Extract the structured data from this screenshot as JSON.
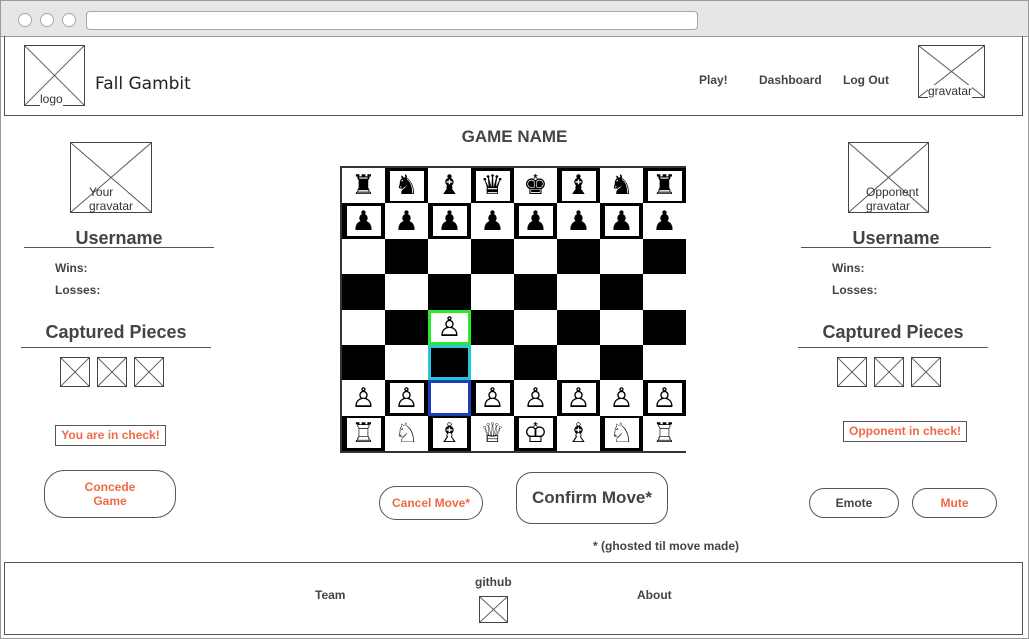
{
  "header": {
    "logo_caption": "logo",
    "brand": "Fall Gambit",
    "nav": [
      {
        "label": "Play!"
      },
      {
        "label": "Dashboard"
      },
      {
        "label": "Log Out"
      }
    ],
    "gravatar_caption": "gravatar"
  },
  "game_name": "GAME NAME",
  "player": {
    "avatar_caption_1": "Your",
    "avatar_caption_2": "gravatar",
    "username": "Username",
    "wins_label": "Wins:",
    "losses_label": "Losses:",
    "captured_title": "Captured Pieces",
    "check_alert": "You are in check!",
    "concede_line1": "Concede",
    "concede_line2": "Game"
  },
  "opponent": {
    "avatar_caption_1": "Opponent",
    "avatar_caption_2": "gravatar",
    "username": "Username",
    "wins_label": "Wins:",
    "losses_label": "Losses:",
    "captured_title": "Captured Pieces",
    "check_alert": "Opponent in check!",
    "emote_label": "Emote",
    "mute_label": "Mute"
  },
  "controls": {
    "cancel_label": "Cancel Move*",
    "confirm_label": "Confirm Move*",
    "note": "* (ghosted til move made)"
  },
  "board": {
    "rows": [
      [
        "♜",
        "♞",
        "♝",
        "♛",
        "♚",
        "♝",
        "♞",
        "♜"
      ],
      [
        "♟",
        "♟",
        "♟",
        "♟",
        "♟",
        "♟",
        "♟",
        "♟"
      ],
      [
        "",
        "",
        "",
        "",
        "",
        "",
        "",
        ""
      ],
      [
        "",
        "",
        "",
        "",
        "",
        "",
        "",
        ""
      ],
      [
        "",
        "",
        "♙",
        "",
        "",
        "",
        "",
        ""
      ],
      [
        "",
        "",
        "",
        "",
        "",
        "",
        "",
        ""
      ],
      [
        "♙",
        "♙",
        "",
        "♙",
        "♙",
        "♙",
        "♙",
        "♙"
      ],
      [
        "♖",
        "♘",
        "♗",
        "♕",
        "♔",
        "♗",
        "♘",
        "♖"
      ]
    ],
    "highlights": [
      {
        "row": 4,
        "col": 2,
        "color": "#2ee82e",
        "meaning": "selected-piece"
      },
      {
        "row": 5,
        "col": 2,
        "color": "#29c4d8",
        "meaning": "path"
      },
      {
        "row": 6,
        "col": 2,
        "color": "#1a3fb8",
        "meaning": "origin"
      }
    ]
  },
  "footer": {
    "team": "Team",
    "github": "github",
    "about": "About"
  },
  "colors": {
    "accent": "#f06a45"
  }
}
